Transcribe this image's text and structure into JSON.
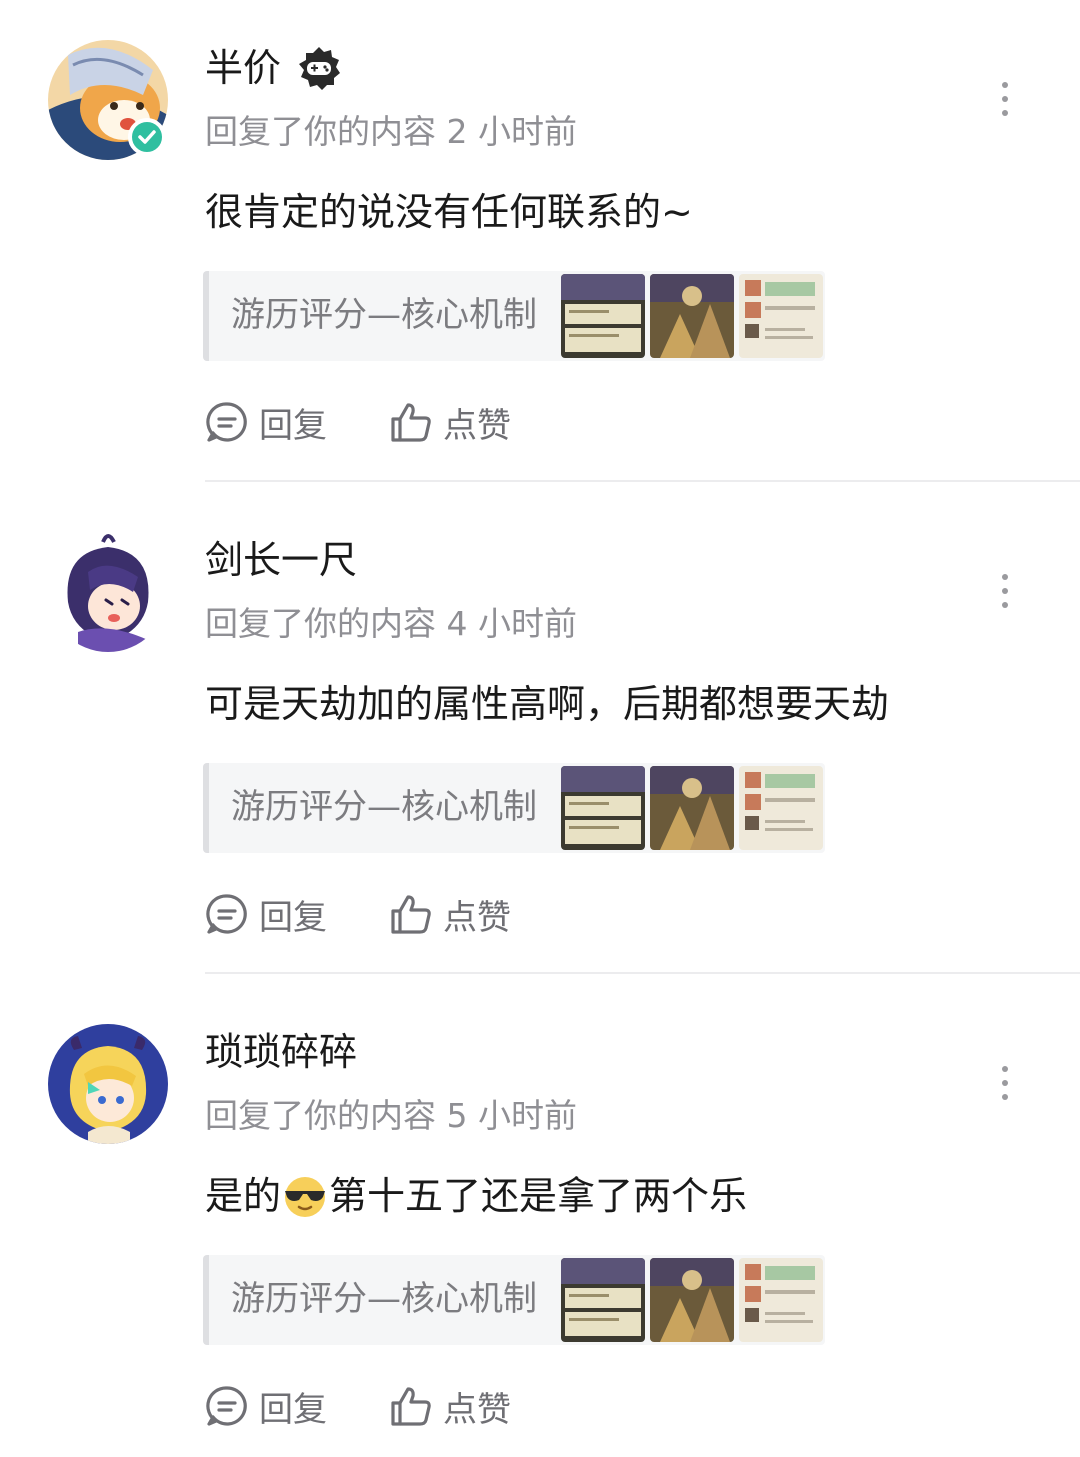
{
  "comments": [
    {
      "username": "半价",
      "has_badge": true,
      "verified": true,
      "meta": "回复了你的内容 2 小时前",
      "content": "很肯定的说没有任何联系的~",
      "content_suffix": "",
      "quoted_post_title": "游历评分—核心机制",
      "actions": {
        "reply": "回复",
        "like": "点赞"
      }
    },
    {
      "username": "剑长一尺",
      "has_badge": false,
      "verified": false,
      "meta": "回复了你的内容 4 小时前",
      "content": "可是天劫加的属性高啊，后期都想要天劫",
      "content_suffix": "",
      "quoted_post_title": "游历评分—核心机制",
      "actions": {
        "reply": "回复",
        "like": "点赞"
      }
    },
    {
      "username": "琐琐碎碎",
      "has_badge": false,
      "verified": false,
      "meta": "回复了你的内容 5 小时前",
      "content": "是的",
      "content_emoji": "sunglasses-emoji",
      "content_suffix": "第十五了还是拿了两个乐",
      "quoted_post_title": "游历评分—核心机制",
      "actions": {
        "reply": "回复",
        "like": "点赞"
      }
    }
  ],
  "icons": {
    "more": "more-vertical-icon",
    "reply": "comment-bubble-icon",
    "like": "thumbs-up-icon",
    "verified": "verified-check-icon",
    "badge": "gamepad-badge-icon"
  },
  "colors": {
    "text_primary": "#1a1a1a",
    "text_secondary": "#8f8f94",
    "verified": "#2fbfa0",
    "quote_bg": "#f5f6f7"
  }
}
